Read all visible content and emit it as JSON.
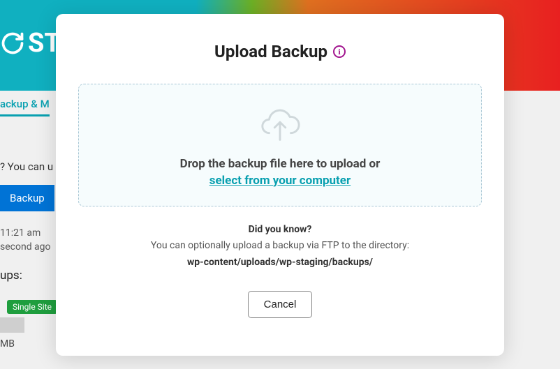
{
  "background": {
    "logo_text": "STA",
    "tab": "ackup & M",
    "line1": "? You can u",
    "button": "Backup",
    "time_line1": "11:21 am",
    "time_line2": "second ago",
    "ups": "ups:",
    "badge": "Single Site",
    "mb": "MB"
  },
  "modal": {
    "title": "Upload Backup",
    "info_char": "i",
    "drop_text": "Drop the backup file here to upload or",
    "select_link": "select from your computer",
    "tip_title": "Did you know?",
    "tip_text": "You can optionally upload a backup via FTP to the directory:",
    "tip_path": "wp-content/uploads/wp-staging/backups/",
    "cancel": "Cancel"
  }
}
